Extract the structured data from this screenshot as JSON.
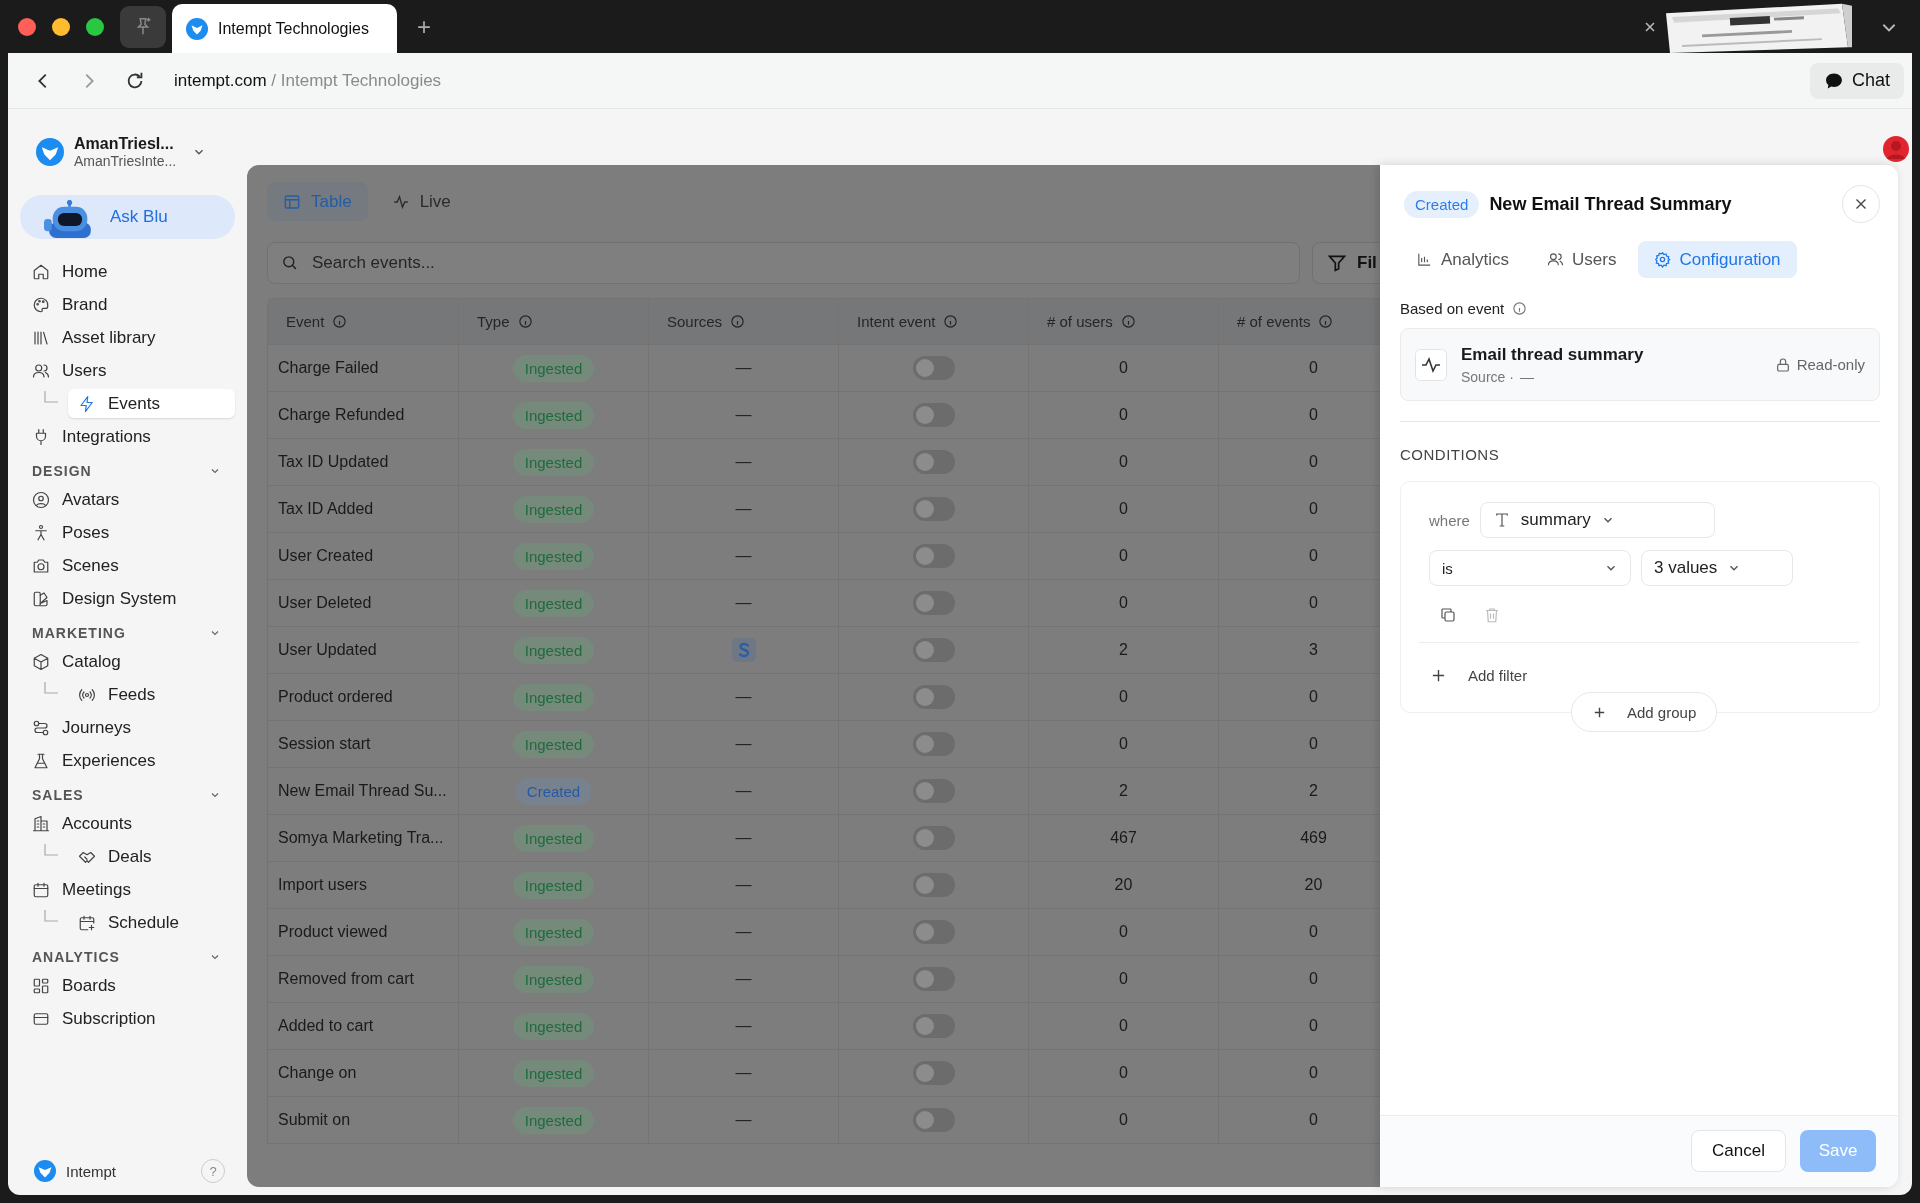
{
  "browser": {
    "tab_title": "Intempt Technologies",
    "new_tab": "+",
    "domain": "intempt.com",
    "path": "/ Intempt Technologies",
    "chat_button": "Chat"
  },
  "workspace": {
    "name": "AmanTriesI...",
    "subtitle": "AmanTriesInte..."
  },
  "ask_button": "Ask Blu",
  "nav": [
    {
      "items": [
        {
          "label": "Home",
          "selected": false
        },
        {
          "label": "Brand",
          "selected": false
        },
        {
          "label": "Asset library",
          "selected": false
        },
        {
          "label": "Users",
          "selected": false,
          "children": [
            {
              "label": "Events",
              "selected": true
            }
          ]
        },
        {
          "label": "Integrations",
          "selected": false
        }
      ]
    },
    {
      "heading": "DESIGN",
      "expanded": true,
      "items": [
        {
          "label": "Avatars",
          "selected": false
        },
        {
          "label": "Poses",
          "selected": false
        },
        {
          "label": "Scenes",
          "selected": false
        },
        {
          "label": "Design System",
          "selected": false
        }
      ]
    },
    {
      "heading": "MARKETING",
      "expanded": true,
      "items": [
        {
          "label": "Catalog",
          "selected": false,
          "children": [
            {
              "label": "Feeds",
              "selected": false
            }
          ]
        },
        {
          "label": "Journeys",
          "selected": false
        },
        {
          "label": "Experiences",
          "selected": false
        }
      ]
    },
    {
      "heading": "SALES",
      "expanded": true,
      "items": [
        {
          "label": "Accounts",
          "selected": false,
          "children": [
            {
              "label": "Deals",
              "selected": false
            }
          ]
        },
        {
          "label": "Meetings",
          "selected": false,
          "children": [
            {
              "label": "Schedule",
              "selected": false
            }
          ]
        }
      ]
    },
    {
      "heading": "ANALYTICS",
      "expanded": true,
      "items": [
        {
          "label": "Boards",
          "selected": false
        },
        {
          "label": "Subscription",
          "selected": false
        }
      ]
    }
  ],
  "footer": {
    "brand": "Intempt",
    "help": "?"
  },
  "view_tabs": [
    {
      "label": "Table",
      "selected": true
    },
    {
      "label": "Live",
      "selected": false
    }
  ],
  "search": {
    "placeholder": "Search events..."
  },
  "filter_button": "Fil",
  "table": {
    "columns": [
      "Event",
      "Type",
      "Sources",
      "Intent event",
      "# of users",
      "# of events"
    ],
    "rows": [
      {
        "event": "Charge Failed",
        "type": {
          "label": "Ingested",
          "kind": "ingested"
        },
        "source": {
          "kind": "none",
          "text": "—"
        },
        "intent_on": false,
        "users": "0",
        "events": "0"
      },
      {
        "event": "Charge Refunded",
        "type": {
          "label": "Ingested",
          "kind": "ingested"
        },
        "source": {
          "kind": "none",
          "text": "—"
        },
        "intent_on": false,
        "users": "0",
        "events": "0"
      },
      {
        "event": "Tax ID Updated",
        "type": {
          "label": "Ingested",
          "kind": "ingested"
        },
        "source": {
          "kind": "none",
          "text": "—"
        },
        "intent_on": false,
        "users": "0",
        "events": "0"
      },
      {
        "event": "Tax ID Added",
        "type": {
          "label": "Ingested",
          "kind": "ingested"
        },
        "source": {
          "kind": "none",
          "text": "—"
        },
        "intent_on": false,
        "users": "0",
        "events": "0"
      },
      {
        "event": "User Created",
        "type": {
          "label": "Ingested",
          "kind": "ingested"
        },
        "source": {
          "kind": "none",
          "text": "—"
        },
        "intent_on": false,
        "users": "0",
        "events": "0"
      },
      {
        "event": "User Deleted",
        "type": {
          "label": "Ingested",
          "kind": "ingested"
        },
        "source": {
          "kind": "none",
          "text": "—"
        },
        "intent_on": false,
        "users": "0",
        "events": "0"
      },
      {
        "event": "User Updated",
        "type": {
          "label": "Ingested",
          "kind": "ingested"
        },
        "source": {
          "kind": "logo"
        },
        "intent_on": false,
        "users": "2",
        "events": "3"
      },
      {
        "event": "Product ordered",
        "type": {
          "label": "Ingested",
          "kind": "ingested"
        },
        "source": {
          "kind": "none",
          "text": "—"
        },
        "intent_on": false,
        "users": "0",
        "events": "0"
      },
      {
        "event": "Session start",
        "type": {
          "label": "Ingested",
          "kind": "ingested"
        },
        "source": {
          "kind": "none",
          "text": "—"
        },
        "intent_on": false,
        "users": "0",
        "events": "0"
      },
      {
        "event": "New Email Thread Su...",
        "type": {
          "label": "Created",
          "kind": "created"
        },
        "source": {
          "kind": "none",
          "text": "—"
        },
        "intent_on": false,
        "users": "2",
        "events": "2"
      },
      {
        "event": "Somya Marketing Tra...",
        "type": {
          "label": "Ingested",
          "kind": "ingested"
        },
        "source": {
          "kind": "none",
          "text": "—"
        },
        "intent_on": false,
        "users": "467",
        "events": "469"
      },
      {
        "event": "Import users",
        "type": {
          "label": "Ingested",
          "kind": "ingested"
        },
        "source": {
          "kind": "none",
          "text": "—"
        },
        "intent_on": false,
        "users": "20",
        "events": "20"
      },
      {
        "event": "Product viewed",
        "type": {
          "label": "Ingested",
          "kind": "ingested"
        },
        "source": {
          "kind": "none",
          "text": "—"
        },
        "intent_on": false,
        "users": "0",
        "events": "0"
      },
      {
        "event": "Removed from cart",
        "type": {
          "label": "Ingested",
          "kind": "ingested"
        },
        "source": {
          "kind": "none",
          "text": "—"
        },
        "intent_on": false,
        "users": "0",
        "events": "0"
      },
      {
        "event": "Added to cart",
        "type": {
          "label": "Ingested",
          "kind": "ingested"
        },
        "source": {
          "kind": "none",
          "text": "—"
        },
        "intent_on": false,
        "users": "0",
        "events": "0"
      },
      {
        "event": "Change on",
        "type": {
          "label": "Ingested",
          "kind": "ingested"
        },
        "source": {
          "kind": "none",
          "text": "—"
        },
        "intent_on": false,
        "users": "0",
        "events": "0"
      },
      {
        "event": "Submit on",
        "type": {
          "label": "Ingested",
          "kind": "ingested"
        },
        "source": {
          "kind": "none",
          "text": "—"
        },
        "intent_on": false,
        "users": "0",
        "events": "0"
      }
    ]
  },
  "panel": {
    "badge": "Created",
    "title": "New Email Thread Summary",
    "tabs": [
      {
        "label": "Analytics",
        "selected": false
      },
      {
        "label": "Users",
        "selected": false
      },
      {
        "label": "Configuration",
        "selected": true
      }
    ],
    "based_on_label": "Based on event",
    "event": {
      "name": "Email thread summary",
      "source_label": "Source ·",
      "source_value": "—",
      "readonly": "Read-only"
    },
    "conditions_heading": "CONDITIONS",
    "condition": {
      "where": "where",
      "property": "summary",
      "operator": "is",
      "value": "3 values"
    },
    "add_filter": "Add filter",
    "add_group": "Add group",
    "cancel": "Cancel",
    "save": {
      "label": "Save",
      "disabled": true
    }
  }
}
